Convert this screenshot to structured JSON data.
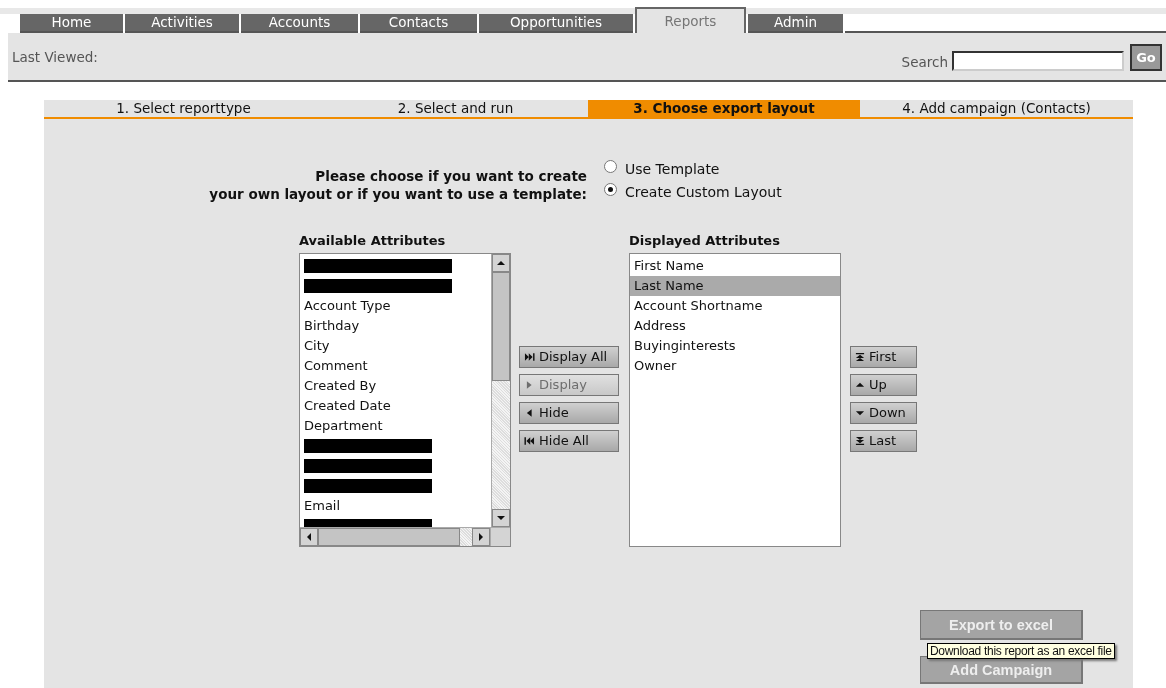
{
  "nav": {
    "tabs": [
      {
        "label": "Home",
        "selected": false
      },
      {
        "label": "Activities",
        "selected": false
      },
      {
        "label": "Accounts",
        "selected": false
      },
      {
        "label": "Contacts",
        "selected": false
      },
      {
        "label": "Opportunities",
        "selected": false
      },
      {
        "label": "Reports",
        "selected": true
      },
      {
        "label": "Admin",
        "selected": false
      }
    ]
  },
  "header": {
    "last_viewed_label": "Last Viewed:",
    "search_label": "Search",
    "go_button": "Go"
  },
  "steps": [
    {
      "label": "1. Select reporttype",
      "selected": false
    },
    {
      "label": "2. Select and run",
      "selected": false
    },
    {
      "label": "3. Choose export layout",
      "selected": true
    },
    {
      "label": "4. Add campaign (Contacts)",
      "selected": false
    }
  ],
  "layout_choice": {
    "prompt_lines": [
      "Please choose if you want to create",
      "your own layout or if you want to use a template:"
    ],
    "options": [
      {
        "label": "Use Template",
        "selected": false
      },
      {
        "label": "Create Custom Layout",
        "selected": true
      }
    ]
  },
  "available": {
    "title": "Available Attributes",
    "items": [
      {
        "kind": "redacted",
        "selected": false
      },
      {
        "kind": "redacted",
        "selected": false
      },
      {
        "kind": "text",
        "label": "Account Type",
        "selected": false
      },
      {
        "kind": "text",
        "label": "Birthday",
        "selected": false
      },
      {
        "kind": "text",
        "label": "City",
        "selected": false
      },
      {
        "kind": "text",
        "label": "Comment",
        "selected": false
      },
      {
        "kind": "text",
        "label": "Created By",
        "selected": false
      },
      {
        "kind": "text",
        "label": "Created Date",
        "selected": false
      },
      {
        "kind": "text",
        "label": "Department",
        "selected": false
      },
      {
        "kind": "redacted",
        "selected": false
      },
      {
        "kind": "redacted",
        "selected": false
      },
      {
        "kind": "redacted",
        "selected": false
      },
      {
        "kind": "text",
        "label": "Email",
        "selected": false
      },
      {
        "kind": "redacted",
        "selected": false
      }
    ]
  },
  "move_buttons": [
    {
      "kind": "display_all",
      "label": "Display All",
      "disabled": false
    },
    {
      "kind": "display",
      "label": "Display",
      "disabled": true
    },
    {
      "kind": "hide",
      "label": "Hide",
      "disabled": false
    },
    {
      "kind": "hide_all",
      "label": "Hide All",
      "disabled": false
    }
  ],
  "displayed": {
    "title": "Displayed Attributes",
    "items": [
      {
        "label": "First Name",
        "selected": false
      },
      {
        "label": "Last Name",
        "selected": true
      },
      {
        "label": "Account Shortname",
        "selected": false
      },
      {
        "label": "Address",
        "selected": false
      },
      {
        "label": "Buyinginterests",
        "selected": false
      },
      {
        "label": "Owner",
        "selected": false
      }
    ]
  },
  "order_buttons": [
    {
      "kind": "first",
      "label": "First"
    },
    {
      "kind": "up",
      "label": "Up"
    },
    {
      "kind": "down",
      "label": "Down"
    },
    {
      "kind": "last",
      "label": "Last"
    }
  ],
  "actions": {
    "export_button": "Export to excel",
    "tooltip": "Download this report as an excel file",
    "campaign_button": "Add Campaign"
  }
}
